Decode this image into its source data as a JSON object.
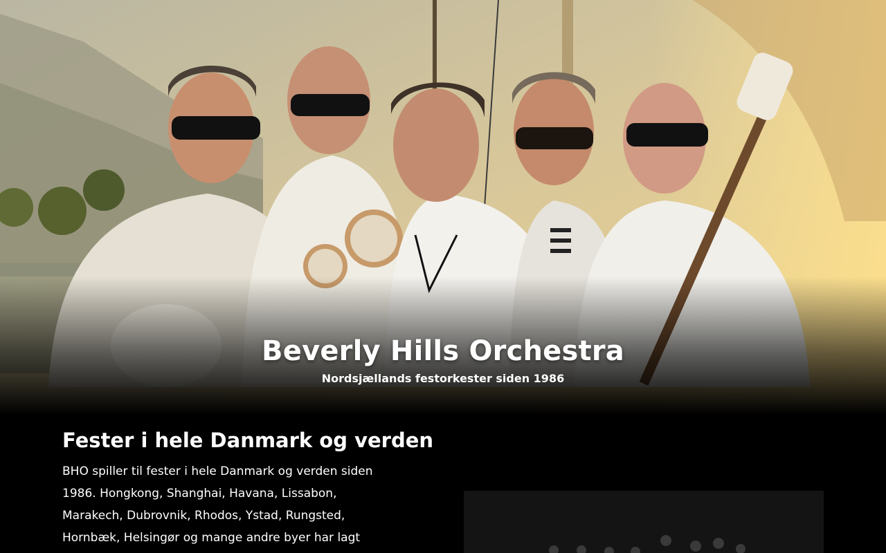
{
  "hero": {
    "title": "Beverly Hills Orchestra",
    "subtitle": "Nordsjællands festorkester siden 1986"
  },
  "intro": {
    "heading": "Fester i hele Danmark og verden",
    "body": "BHO spiller til fester i hele Danmark og verden siden 1986. Hongkong, Shanghai, Havana, Lissabon, Marakech, Dubrovnik, Rhodos, Ystad, Rungsted, Hornbæk, Helsingør og mange andre byer har lagt"
  }
}
